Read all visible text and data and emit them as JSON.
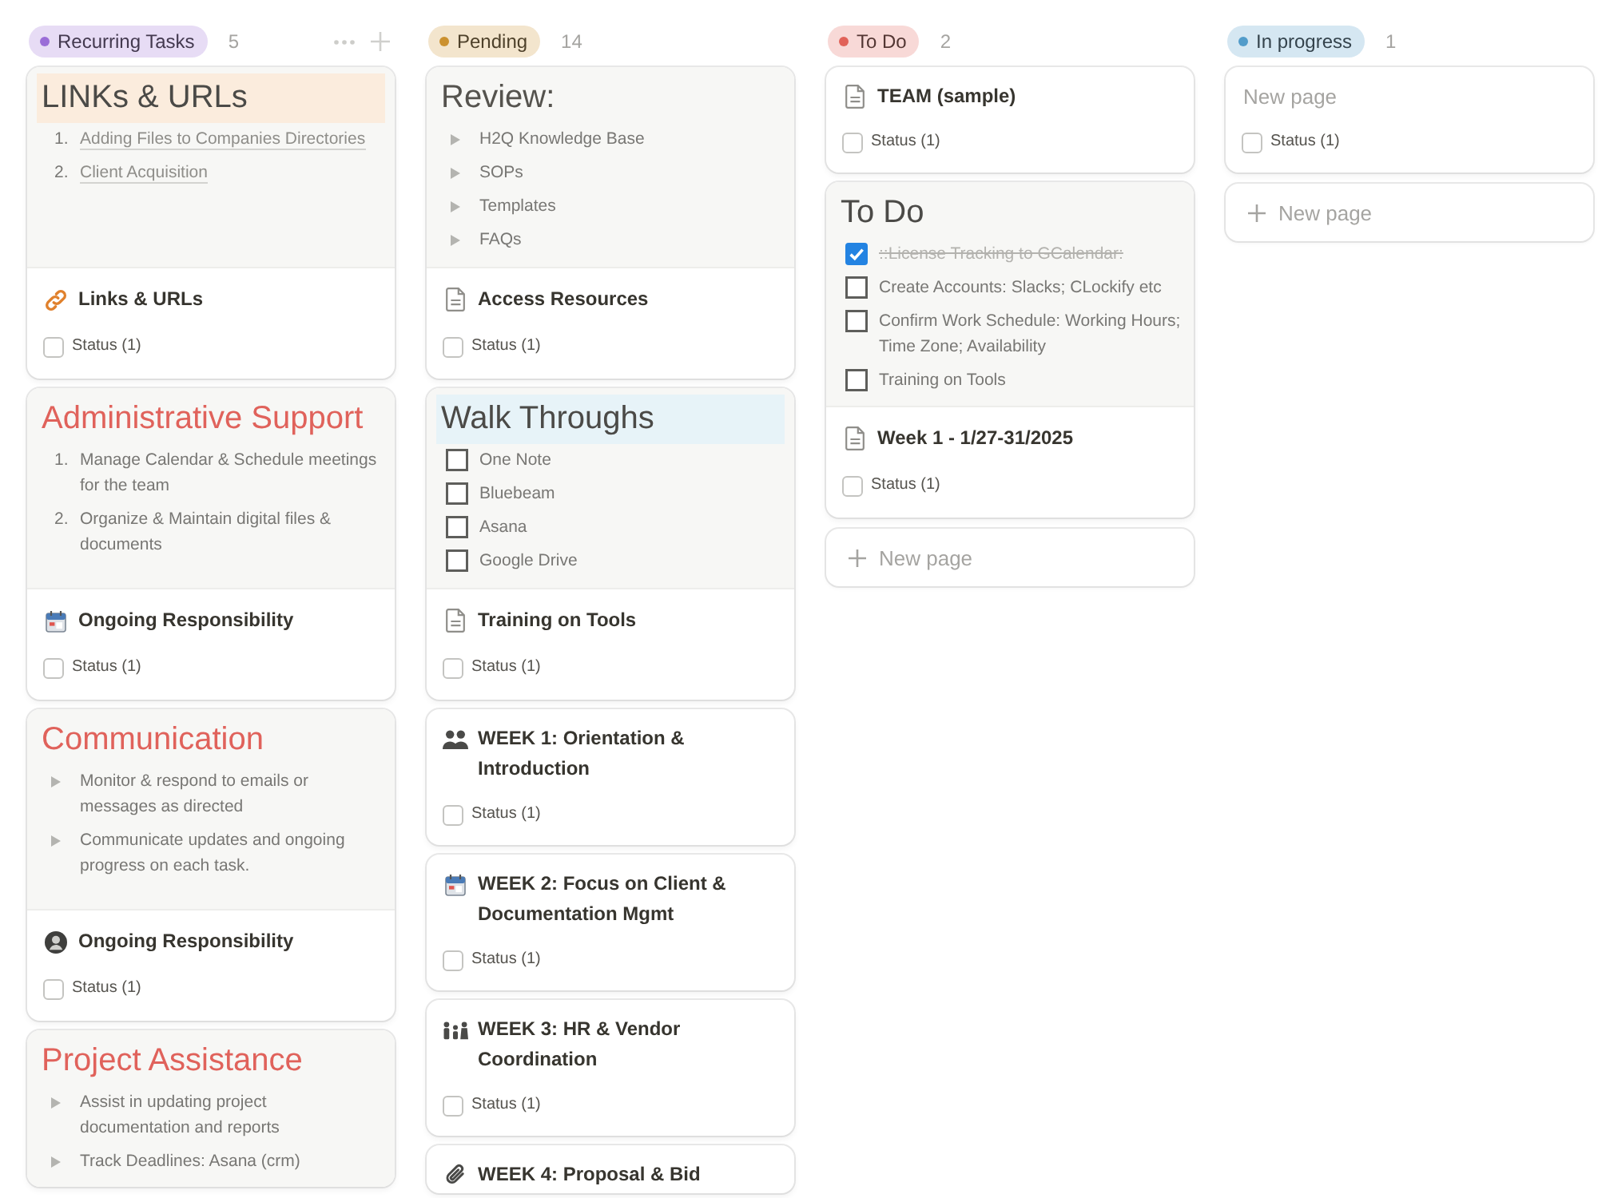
{
  "columns": [
    {
      "group": {
        "label": "Recurring Tasks",
        "color": "#9a6dd7",
        "count": "5",
        "hovered": true
      },
      "cards": [
        {
          "preview": {
            "heading": {
              "text": "LINKs & URLs",
              "color": "#4b4a47",
              "highlight": {
                "color": "#fbecdd"
              }
            },
            "list": {
              "kind": "numbered",
              "items": [
                {
                  "number": "1.",
                  "text": "Adding Files to Companies Directories",
                  "link": true
                },
                {
                  "number": "2.",
                  "text": "Client Acquisition",
                  "link": true
                }
              ]
            }
          },
          "title": {
            "text": "Links & URLs",
            "kind": "link"
          },
          "status": {
            "label": "Status (1)",
            "checked": false
          }
        },
        {
          "preview": {
            "heading": {
              "text": "Administrative Support",
              "color": "#e0625b"
            },
            "list": {
              "kind": "numbered",
              "items": [
                {
                  "number": "1.",
                  "text": "Manage Calendar & Schedule meetings for the team"
                },
                {
                  "number": "2.",
                  "text": "Organize & Maintain digital files & documents"
                }
              ]
            }
          },
          "title": {
            "text": "Ongoing Responsibility",
            "kind": "calendar"
          },
          "status": {
            "label": "Status (1)",
            "checked": false
          }
        },
        {
          "preview": {
            "heading": {
              "text": "Communication",
              "color": "#e0625b"
            },
            "list": {
              "kind": "toggle",
              "items": [
                {
                  "text": "Monitor & respond to emails or messages as directed",
                  "expanded": false
                },
                {
                  "text": "Communicate updates and ongoing progress on each task.",
                  "expanded": false
                }
              ]
            }
          },
          "title": {
            "text": "Ongoing Responsibility",
            "kind": "person"
          },
          "status": {
            "label": "Status (1)",
            "checked": false
          }
        },
        {
          "preview": {
            "heading": {
              "text": "Project Assistance",
              "color": "#e0625b"
            },
            "list": {
              "kind": "toggle",
              "items": [
                {
                  "text": "Assist in updating project documentation and reports",
                  "expanded": false
                },
                {
                  "text": "Track Deadlines: Asana (crm)",
                  "expanded": false
                }
              ]
            }
          }
        }
      ]
    },
    {
      "group": {
        "label": "Pending",
        "color": "#cb912f",
        "count": "14",
        "hovered": false
      },
      "cards": [
        {
          "preview": {
            "heading": {
              "text": "Review:",
              "color": "#55534e"
            },
            "list": {
              "kind": "toggle",
              "items": [
                {
                  "text": "H2Q Knowledge Base",
                  "expanded": false
                },
                {
                  "text": "SOPs",
                  "expanded": false
                },
                {
                  "text": "Templates",
                  "expanded": false
                },
                {
                  "text": "FAQs",
                  "expanded": false
                }
              ]
            }
          },
          "title": {
            "text": "Access Resources",
            "kind": "page"
          },
          "status": {
            "label": "Status (1)",
            "checked": false
          }
        },
        {
          "preview": {
            "heading": {
              "text": "Walk Throughs",
              "color": "#4b4a47",
              "highlight": {
                "color": "#e7f3f8"
              }
            },
            "list": {
              "kind": "todo",
              "items": [
                {
                  "text": "One Note",
                  "checked": false
                },
                {
                  "text": "Bluebeam",
                  "checked": false
                },
                {
                  "text": "Asana",
                  "checked": false
                },
                {
                  "text": "Google Drive",
                  "checked": false
                }
              ]
            }
          },
          "title": {
            "text": "Training on Tools",
            "kind": "page"
          },
          "status": {
            "label": "Status (1)",
            "checked": false
          }
        },
        {
          "title": {
            "text": "WEEK 1: Orientation & Introduction",
            "kind": "people"
          },
          "status": {
            "label": "Status (1)",
            "checked": false
          }
        },
        {
          "title": {
            "text": "WEEK 2: Focus on Client & Documentation Mgmt",
            "kind": "calendar"
          },
          "status": {
            "label": "Status (1)",
            "checked": false
          }
        },
        {
          "title": {
            "text": "WEEK 3: HR & Vendor Coordination",
            "kind": "family"
          },
          "status": {
            "label": "Status (1)",
            "checked": false
          }
        },
        {
          "title": {
            "text": "WEEK 4: Proposal & Bid",
            "kind": "paperclip"
          }
        }
      ]
    },
    {
      "group": {
        "label": "To Do",
        "color": "#e16259",
        "count": "2",
        "hovered": false
      },
      "cards": [
        {
          "title": {
            "text": "TEAM (sample)",
            "kind": "page"
          },
          "status": {
            "label": "Status (1)",
            "checked": false
          }
        },
        {
          "preview": {
            "heading": {
              "text": "To Do",
              "color": "#4b4a47"
            },
            "list": {
              "kind": "todo",
              "items": [
                {
                  "text": "::License Tracking to GCalendar:",
                  "checked": true
                },
                {
                  "text": "Create Accounts: Slacks; CLockify etc",
                  "checked": false
                },
                {
                  "text": "Confirm Work Schedule: Working Hours; Time Zone; Availability",
                  "checked": false
                },
                {
                  "text": "Training on Tools",
                  "checked": false
                }
              ]
            }
          },
          "title": {
            "text": "Week 1 - 1/27-31/2025",
            "kind": "page"
          },
          "status": {
            "label": "Status (1)",
            "checked": false
          }
        }
      ],
      "new_page": "New page"
    },
    {
      "group": {
        "label": "In progress",
        "color": "#529cca",
        "count": "1",
        "hovered": false
      },
      "cards": [
        {
          "title": {
            "placeholder": "New page"
          },
          "status": {
            "label": "Status (1)",
            "checked": false
          }
        }
      ],
      "new_page": "New page"
    }
  ]
}
